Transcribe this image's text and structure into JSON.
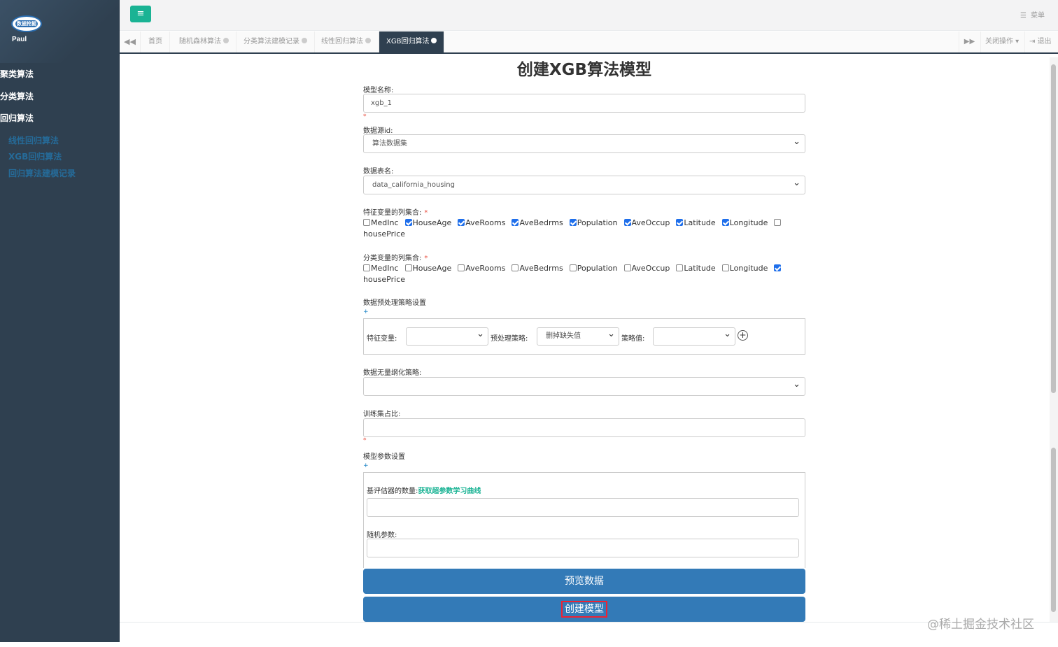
{
  "sidebar": {
    "logo_text": "数据挖掘",
    "username": "Paul",
    "menu": [
      {
        "label": "聚类算法"
      },
      {
        "label": "分类算法"
      },
      {
        "label": "回归算法"
      }
    ],
    "submenu": [
      {
        "label": "线性回归算法"
      },
      {
        "label": "XGB回归算法"
      },
      {
        "label": "回归算法建模记录"
      }
    ]
  },
  "header": {
    "menu_toggle_icon": "≡",
    "menu_label": "菜单"
  },
  "tabs": {
    "items": [
      {
        "label": "首页"
      },
      {
        "label": "随机森林算法"
      },
      {
        "label": "分类算法建模记录"
      },
      {
        "label": "线性回归算法"
      },
      {
        "label": "XGB回归算法"
      }
    ],
    "close_ops": "关闭操作",
    "logout": "退出"
  },
  "form": {
    "title": "创建XGB算法模型",
    "model_name_label": "模型名称:",
    "model_name_value": "xgb_1",
    "datasource_label": "数据源id:",
    "datasource_value": "算法数据集",
    "table_label": "数据表名:",
    "table_value": "data_california_housing",
    "feature_label": "特征变量的列集合:",
    "category_label": "分类变量的列集合:",
    "required_mark": "*",
    "columns": [
      "MedInc",
      "HouseAge",
      "AveRooms",
      "AveBedrms",
      "Population",
      "AveOccup",
      "Latitude",
      "Longitude",
      "housePrice"
    ],
    "feature_checked": [
      false,
      true,
      true,
      true,
      true,
      true,
      true,
      true,
      false
    ],
    "category_checked": [
      false,
      false,
      false,
      false,
      false,
      false,
      false,
      false,
      true
    ],
    "preprocess_label": "数据预处理策略设置",
    "add_mark": "+",
    "pre_feature_label": "特征变量:",
    "pre_feature_value": "",
    "pre_strategy_label": "预处理策略:",
    "pre_strategy_value": "删掉缺失值",
    "pre_value_label": "策略值:",
    "pre_value_value": "",
    "dimensionless_label": "数据无量纲化策略:",
    "dimensionless_value": "",
    "train_ratio_label": "训练集占比:",
    "train_ratio_value": "",
    "params_label": "模型参数设置",
    "estimators_label": "基评估器的数量:",
    "learning_curve_link": "获取超参数学习曲线",
    "estimators_value": "",
    "random_label": "随机参数:",
    "random_value": "",
    "preview_button": "预览数据",
    "create_button": "创建模型"
  },
  "watermark": "@稀土掘金技术社区"
}
